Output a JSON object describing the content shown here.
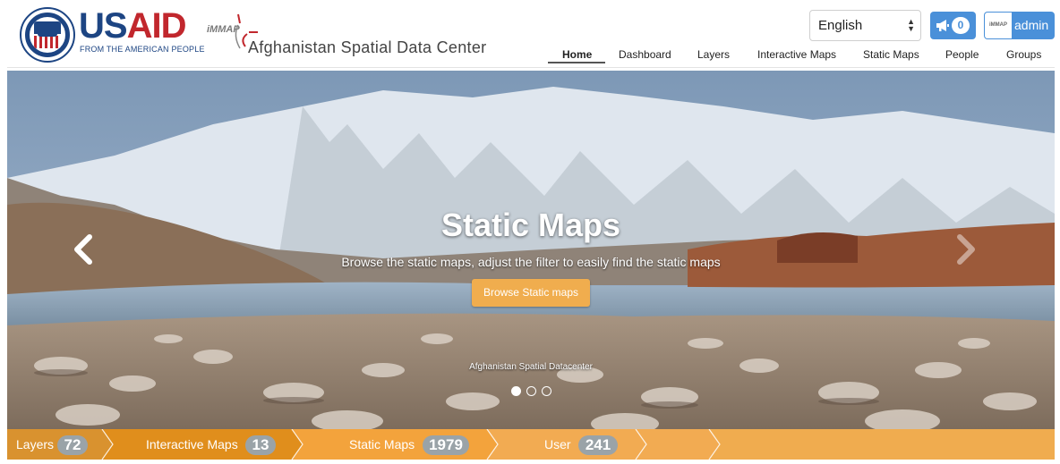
{
  "header": {
    "logo_usaid_prefix": "US",
    "logo_usaid_suffix": "AID",
    "logo_usaid_tagline": "FROM THE AMERICAN PEOPLE",
    "seal_text": "UNITED STATES AGENCY FOR INTERNATIONAL DEVELOPMENT",
    "logo_immap": "iMMAP",
    "site_title": "Afghanistan Spatial Data Center",
    "language": {
      "selected": "English",
      "options": [
        "English"
      ]
    },
    "notifications": {
      "icon": "megaphone-icon",
      "count": "0"
    },
    "user": {
      "avatar_text": "iMMAP",
      "name": "admin"
    }
  },
  "nav": {
    "items": [
      {
        "label": "Home",
        "active": true
      },
      {
        "label": "Dashboard",
        "active": false
      },
      {
        "label": "Layers",
        "active": false
      },
      {
        "label": "Interactive Maps",
        "active": false
      },
      {
        "label": "Static Maps",
        "active": false
      },
      {
        "label": "People",
        "active": false
      },
      {
        "label": "Groups",
        "active": false
      }
    ]
  },
  "carousel": {
    "title": "Static Maps",
    "description": "Browse the static maps, adjust the filter to easily find the static maps",
    "button_label": "Browse Static maps",
    "credit": "Afghanistan Spatial Datacenter",
    "slide_count": 3,
    "active_slide": 1,
    "prev_icon": "chevron-left-icon",
    "next_icon": "chevron-right-icon"
  },
  "stats": [
    {
      "label": "Layers",
      "count": "72"
    },
    {
      "label": "Interactive Maps",
      "count": "13"
    },
    {
      "label": "Static Maps",
      "count": "1979"
    },
    {
      "label": "User",
      "count": "241"
    }
  ],
  "colors": {
    "usaid_blue": "#1d4583",
    "usaid_red": "#c1272d",
    "button_blue": "#4a90d9",
    "accent_orange": "#f0ad4e"
  }
}
